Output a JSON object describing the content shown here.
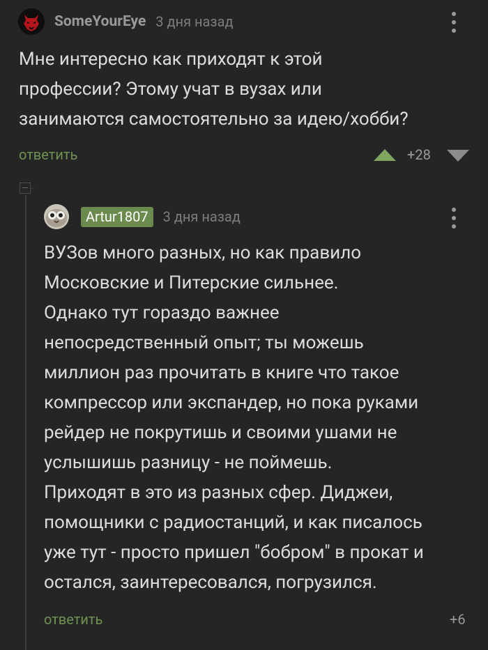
{
  "comment": {
    "author": "SomeYourEye",
    "time": "3 дня назад",
    "text_lines": [
      "Мне интересно как приходят к этой",
      "профессии? Этому учат в вузах или",
      "занимаются самостоятельно за идею/хобби?"
    ],
    "reply_label": "ответить",
    "score": "+28"
  },
  "reply": {
    "author": "Artur1807",
    "time": "3 дня назад",
    "text_lines": [
      "ВУЗов много разных, но как правило",
      "Московские и Питерские сильнее.",
      "Однако тут гораздо важнее",
      "непосредственный опыт; ты можешь",
      "миллион раз прочитать в книге что такое",
      "компрессор или экспандер, но пока руками",
      "рейдер не покрутишь и своими ушами не",
      "услышишь разницу - не поймешь.",
      "Приходят в это из разных сфер. Диджеи,",
      "помощники с радиостанций, и как писалось",
      "уже тут - просто пришел \"бобром\" в прокат и",
      "остался, заинтересовался, погрузился."
    ],
    "reply_label": "ответить",
    "score": "+6"
  },
  "icons": {
    "menu": "kebab-menu-icon",
    "upvote": "arrow-up-icon",
    "downvote": "arrow-down-icon",
    "collapse": "collapse-thread-icon"
  },
  "colors": {
    "background": "#252526",
    "text": "#dcdcdc",
    "meta": "#7c7c7c",
    "accent_green": "#6e9152",
    "badge_green": "#6b8a4d"
  }
}
